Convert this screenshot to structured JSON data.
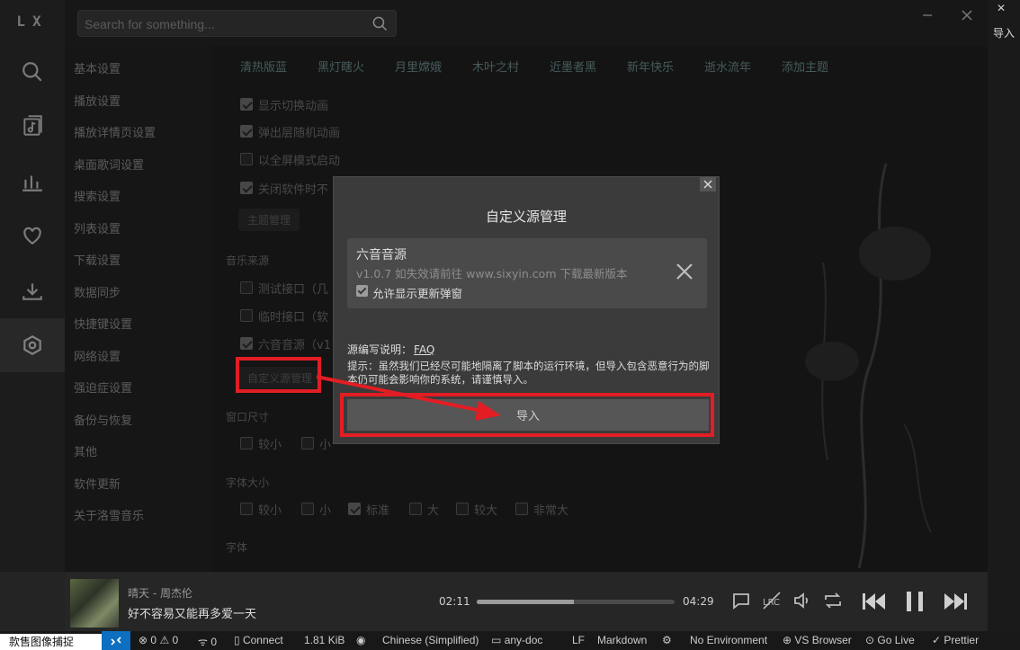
{
  "app": {
    "logo": "LX",
    "search_placeholder": "Search for something..."
  },
  "rail": {
    "icons": [
      "search-icon",
      "music-list-icon",
      "chart-icon",
      "heart-icon",
      "download-icon",
      "settings-icon"
    ]
  },
  "nav": {
    "items": [
      "基本设置",
      "播放设置",
      "播放详情页设置",
      "桌面歌词设置",
      "搜索设置",
      "列表设置",
      "下载设置",
      "数据同步",
      "快捷键设置",
      "网络设置",
      "强迫症设置",
      "备份与恢复",
      "其他",
      "软件更新",
      "关于洛雪音乐"
    ]
  },
  "settings": {
    "themes": [
      "清热版蓝",
      "黑灯瞎火",
      "月里嫦娥",
      "木叶之村",
      "近墨者黑",
      "新年快乐",
      "逝水流年",
      "添加主题"
    ],
    "options": [
      {
        "label": "显示切换动画",
        "checked": true
      },
      {
        "label": "弹出层随机动画",
        "checked": true
      },
      {
        "label": "以全屏模式启动",
        "checked": false
      },
      {
        "label": "关闭软件时不",
        "checked": true
      }
    ],
    "theme_manage_btn": "主题管理",
    "music_source_title": "音乐来源",
    "sources": [
      {
        "label": "测试接口（几",
        "checked": false
      },
      {
        "label": "临时接口（软",
        "checked": false
      },
      {
        "label": "六音音源（v1",
        "checked": true
      }
    ],
    "custom_source_btn": "自定义源管理",
    "window_size_title": "窗口尺寸",
    "window_sizes": [
      {
        "label": "较小",
        "checked": false
      },
      {
        "label": "小",
        "checked": false
      }
    ],
    "font_size_title": "字体大小",
    "font_sizes": [
      {
        "label": "较小",
        "checked": false
      },
      {
        "label": "小",
        "checked": false
      },
      {
        "label": "标准",
        "checked": true
      },
      {
        "label": "大",
        "checked": false
      },
      {
        "label": "较大",
        "checked": false
      },
      {
        "label": "非常大",
        "checked": false
      }
    ],
    "font_title": "字体"
  },
  "dialog": {
    "title": "自定义源管理",
    "source_name": "六音音源",
    "source_desc": "v1.0.7 如失效请前往 www.sixyin.com 下载最新版本",
    "allow_update_popup": "允许显示更新弹窗",
    "help_label": "源编写说明：",
    "help_link": "FAQ",
    "tip": "提示：虽然我们已经尽可能地隔离了脚本的运行环境，但导入包含恶意行为的脚本仍可能会影响你的系统，请谨慎导入。",
    "import_btn": "导入"
  },
  "player": {
    "song": "晴天 - 周杰伦",
    "lyric": "好不容易又能再多爱一天",
    "current_time": "02:11",
    "total_time": "04:29",
    "progress": 0.49
  },
  "strip": {
    "label": "导入"
  },
  "statusbar": {
    "snip_label": "款售图像捕捉",
    "errors": "0",
    "warnings": "0",
    "ports": "0",
    "connect": "Connect",
    "size": "1.81 KiB",
    "language": "Chinese (Simplified)",
    "folder": "any-doc",
    "eol": "LF",
    "mode": "Markdown",
    "env": "No Environment",
    "browser": "VS Browser",
    "golive": "Go Live",
    "prettier": "Prettier"
  },
  "colors": {
    "annotation_red": "#e21d24",
    "remote_blue": "#0e6ec0"
  }
}
